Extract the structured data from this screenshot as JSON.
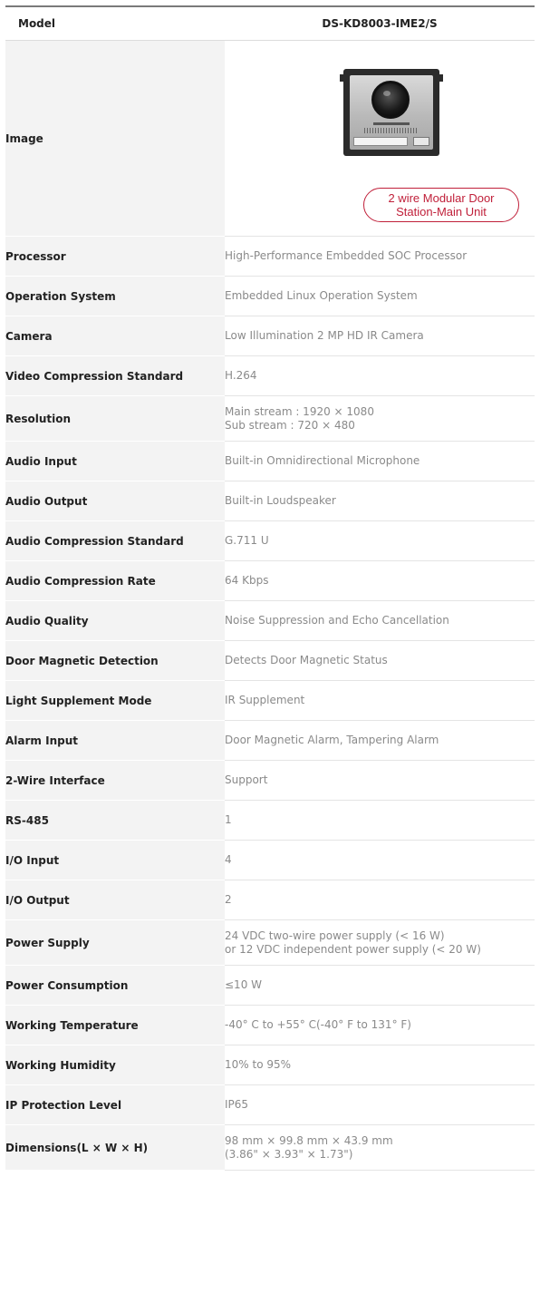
{
  "header": {
    "label": "Model",
    "value": "DS-KD8003-IME2/S"
  },
  "image_row": {
    "label": "Image",
    "caption_line1": "2 wire Modular Door",
    "caption_line2": "Station-Main Unit",
    "caption_color": "#c0203a",
    "device_logo": "HIKVISION"
  },
  "rows": [
    {
      "label": "Processor",
      "lines": [
        "High-Performance Embedded SOC Processor"
      ]
    },
    {
      "label": "Operation System",
      "lines": [
        "Embedded Linux Operation System"
      ]
    },
    {
      "label": "Camera",
      "lines": [
        "Low Illumination 2 MP HD IR Camera"
      ]
    },
    {
      "label": "Video Compression Standard",
      "lines": [
        "H.264"
      ]
    },
    {
      "label": "Resolution",
      "lines": [
        "Main stream : 1920 × 1080",
        "Sub stream : 720 × 480"
      ]
    },
    {
      "label": "Audio Input",
      "lines": [
        "Built-in Omnidirectional Microphone"
      ]
    },
    {
      "label": "Audio Output",
      "lines": [
        "Built-in Loudspeaker"
      ]
    },
    {
      "label": "Audio Compression Standard",
      "lines": [
        "G.711 U"
      ]
    },
    {
      "label": "Audio Compression Rate",
      "lines": [
        "64 Kbps"
      ]
    },
    {
      "label": "Audio Quality",
      "lines": [
        "Noise Suppression and Echo Cancellation"
      ]
    },
    {
      "label": "Door Magnetic Detection",
      "lines": [
        "Detects Door Magnetic Status"
      ]
    },
    {
      "label": "Light Supplement Mode",
      "lines": [
        "IR Supplement"
      ]
    },
    {
      "label": "Alarm Input",
      "lines": [
        "Door Magnetic Alarm, Tampering Alarm"
      ]
    },
    {
      "label": "2-Wire Interface",
      "lines": [
        "Support"
      ]
    },
    {
      "label": "RS-485",
      "lines": [
        "1"
      ]
    },
    {
      "label": "I/O Input",
      "lines": [
        "4"
      ]
    },
    {
      "label": "I/O Output",
      "lines": [
        "2"
      ]
    },
    {
      "label": "Power Supply",
      "lines": [
        "24 VDC two-wire power supply (< 16 W)",
        "or 12 VDC independent power supply (< 20 W)"
      ]
    },
    {
      "label": "Power Consumption",
      "lines": [
        "≤10 W"
      ]
    },
    {
      "label": "Working Temperature",
      "lines": [
        "-40° C to +55° C(-40° F to 131° F)"
      ]
    },
    {
      "label": "Working Humidity",
      "lines": [
        "10% to 95%"
      ]
    },
    {
      "label": "IP Protection Level",
      "lines": [
        "IP65"
      ]
    },
    {
      "label": "Dimensions(L × W × H)",
      "lines": [
        "98 mm × 99.8 mm × 43.9 mm",
        "(3.86\" × 3.93\" × 1.73\")"
      ]
    }
  ]
}
